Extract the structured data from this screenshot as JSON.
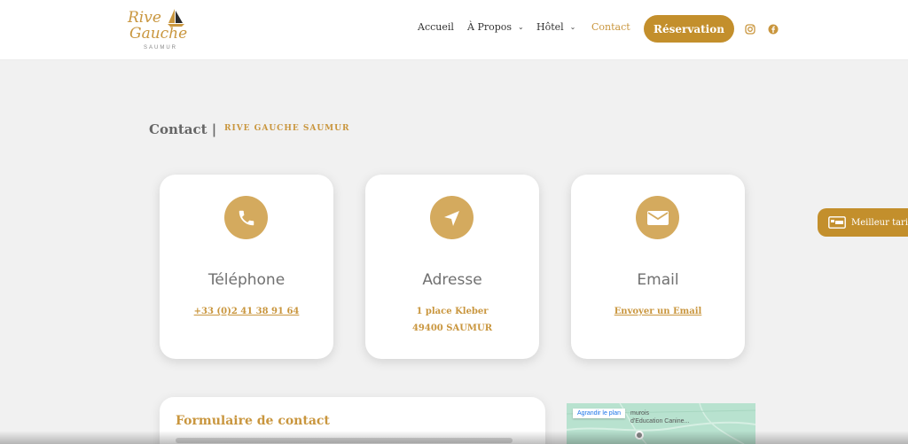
{
  "brand": {
    "line1": "Rive",
    "line2": "Gauche",
    "subtitle": "SAUMUR"
  },
  "nav": {
    "items": [
      {
        "label": "Accueil"
      },
      {
        "label": "À Propos"
      },
      {
        "label": "Hôtel"
      },
      {
        "label": "Contact"
      }
    ],
    "chevron": "⌄",
    "reservation_label": "Réservation",
    "social_icons": [
      "instagram-icon",
      "facebook-icon"
    ]
  },
  "page": {
    "title": "Contact |",
    "subtitle": "RIVE GAUCHE SAUMUR"
  },
  "cards": [
    {
      "icon": "phone-icon",
      "title": "Téléphone",
      "link": "+33 (0)2 41 38 91 64"
    },
    {
      "icon": "location-arrow-icon",
      "title": "Adresse",
      "line1": "1 place Kleber",
      "line2": "49400 SAUMUR"
    },
    {
      "icon": "envelope-icon",
      "title": "Email",
      "link": "Envoyer un Email"
    }
  ],
  "best_rate": {
    "label": "Meilleur tarif",
    "icon": "bed-icon"
  },
  "form": {
    "title": "Formulaire de contact"
  },
  "map": {
    "enlarge_label": "Agrandir le plan",
    "text_line1": "murois",
    "text_line2": "d'Education Canine..."
  },
  "colors": {
    "accent": "#c9963e",
    "button": "#c38f2c",
    "icon_circle": "#d4aa5e",
    "background": "#f1f1f1"
  }
}
